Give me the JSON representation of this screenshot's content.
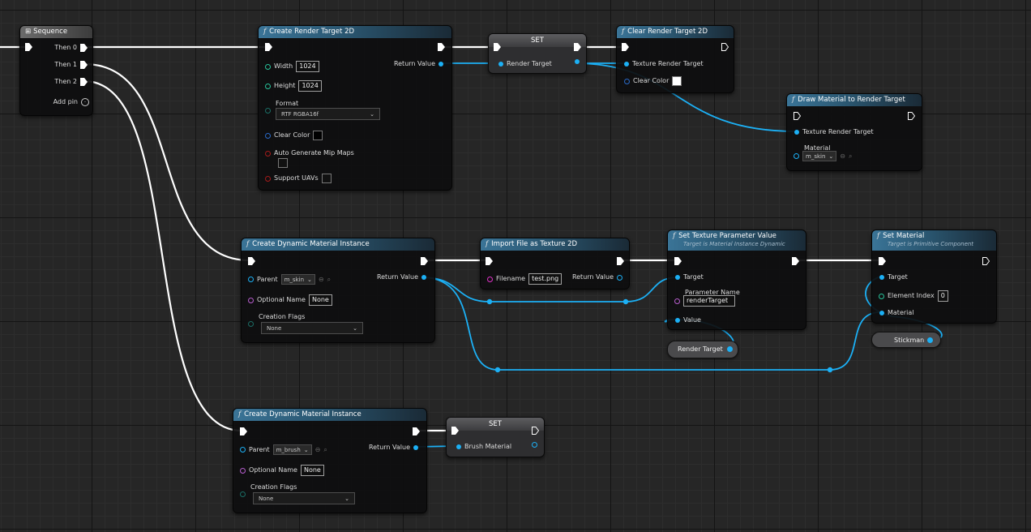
{
  "sequence": {
    "title": "Sequence",
    "then0": "Then 0",
    "then1": "Then 1",
    "then2": "Then 2",
    "add_pin": "Add pin"
  },
  "create_rt": {
    "title": "Create Render Target 2D",
    "width_label": "Width",
    "width_value": "1024",
    "height_label": "Height",
    "height_value": "1024",
    "format_label": "Format",
    "format_value": "RTF RGBA16f",
    "clear_color_label": "Clear Color",
    "auto_mip_label": "Auto Generate Mip Maps",
    "support_uavs_label": "Support UAVs",
    "return_label": "Return Value"
  },
  "set1": {
    "title": "SET",
    "pin": "Render Target"
  },
  "clear_rt": {
    "title": "Clear Render Target 2D",
    "texture_label": "Texture Render Target",
    "clear_color_label": "Clear Color"
  },
  "draw_mat": {
    "title": "Draw Material to Render Target",
    "texture_label": "Texture Render Target",
    "material_label": "Material",
    "material_value": "m_skin"
  },
  "cdmi1": {
    "title": "Create Dynamic Material Instance",
    "parent_label": "Parent",
    "parent_value": "m_skin",
    "optional_name_label": "Optional Name",
    "optional_name_value": "None",
    "creation_flags_label": "Creation Flags",
    "creation_flags_value": "None",
    "return_label": "Return Value"
  },
  "import_file": {
    "title": "Import File as Texture 2D",
    "filename_label": "Filename",
    "filename_value": "test.png",
    "return_label": "Return Value"
  },
  "set_tex_param": {
    "title": "Set Texture Parameter Value",
    "subtitle": "Target is Material Instance Dynamic",
    "target_label": "Target",
    "param_name_label": "Parameter Name",
    "param_name_value": "renderTarget",
    "value_label": "Value"
  },
  "render_target_var": {
    "label": "Render Target"
  },
  "set_material": {
    "title": "Set Material",
    "subtitle": "Target is Primitive Component",
    "target_label": "Target",
    "element_index_label": "Element Index",
    "element_index_value": "0",
    "material_label": "Material"
  },
  "stickman_var": {
    "label": "Stickman"
  },
  "cdmi2": {
    "title": "Create Dynamic Material Instance",
    "parent_label": "Parent",
    "parent_value": "m_brush",
    "optional_name_label": "Optional Name",
    "optional_name_value": "None",
    "creation_flags_label": "Creation Flags",
    "creation_flags_value": "None",
    "return_label": "Return Value"
  },
  "set2": {
    "title": "SET",
    "pin": "Brush Material"
  },
  "colors": {
    "exec_wire": "#ffffff",
    "object_wire": "#1cb0f5",
    "header_blue": "#3a7497",
    "grid_bg": "#262626"
  },
  "icons": {
    "function": "function-icon",
    "sequence": "sequence-icon",
    "exec": "exec-pin-icon",
    "search": "search-icon",
    "browse": "browse-icon"
  }
}
